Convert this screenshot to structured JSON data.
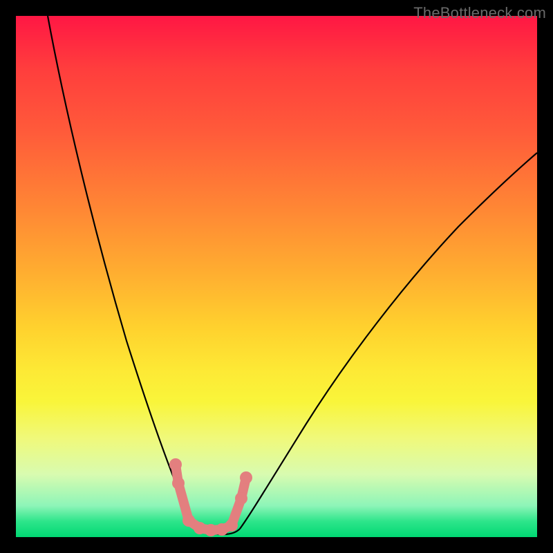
{
  "watermark": "TheBottleneck.com",
  "colors": {
    "frame_bg_top": "#ff1744",
    "frame_bg_bottom": "#00d873",
    "curve": "#000000",
    "marker": "#e37f7f",
    "page_bg": "#000000",
    "watermark_text": "#6a6a6a"
  },
  "chart_data": {
    "type": "line",
    "title": "",
    "xlabel": "",
    "ylabel": "",
    "xlim": [
      0,
      100
    ],
    "ylim": [
      0,
      100
    ],
    "grid": false,
    "legend": false,
    "series": [
      {
        "name": "left-branch",
        "x": [
          6,
          10,
          15,
          20,
          25,
          28,
          30,
          32,
          33.5
        ],
        "y": [
          100,
          72,
          48,
          31,
          17,
          10,
          6,
          3,
          2
        ]
      },
      {
        "name": "valley-floor",
        "x": [
          33.5,
          35,
          37,
          39,
          41,
          42.5
        ],
        "y": [
          2,
          1.5,
          1.2,
          1.3,
          1.8,
          2.5
        ]
      },
      {
        "name": "right-branch",
        "x": [
          42.5,
          46,
          52,
          60,
          70,
          82,
          95,
          100
        ],
        "y": [
          2.5,
          6,
          14,
          26,
          40,
          55,
          69,
          74
        ]
      }
    ],
    "markers": {
      "name": "highlighted-points",
      "x": [
        30.5,
        31,
        33,
        35,
        37,
        39,
        41,
        43,
        44
      ],
      "y": [
        14,
        10,
        3,
        2,
        2,
        2,
        2.5,
        8,
        12
      ],
      "radius": 9,
      "connected": true
    }
  }
}
